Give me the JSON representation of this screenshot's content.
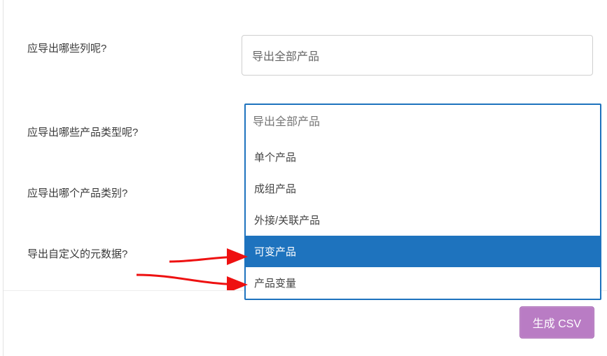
{
  "labels": {
    "row1": "应导出哪些列呢?",
    "row2": "应导出哪些产品类型呢?",
    "row3": "应导出哪个产品类别?",
    "row4": "导出自定义的元数据?"
  },
  "fields": {
    "columns_select_value": "导出全部产品"
  },
  "dropdown": {
    "search_placeholder": "导出全部产品",
    "options": {
      "o0": "单个产品",
      "o1": "成组产品",
      "o2": "外接/关联产品",
      "o3": "可变产品",
      "o4": "产品变量"
    },
    "selected_index": 3
  },
  "buttons": {
    "generate": "生成 CSV"
  }
}
